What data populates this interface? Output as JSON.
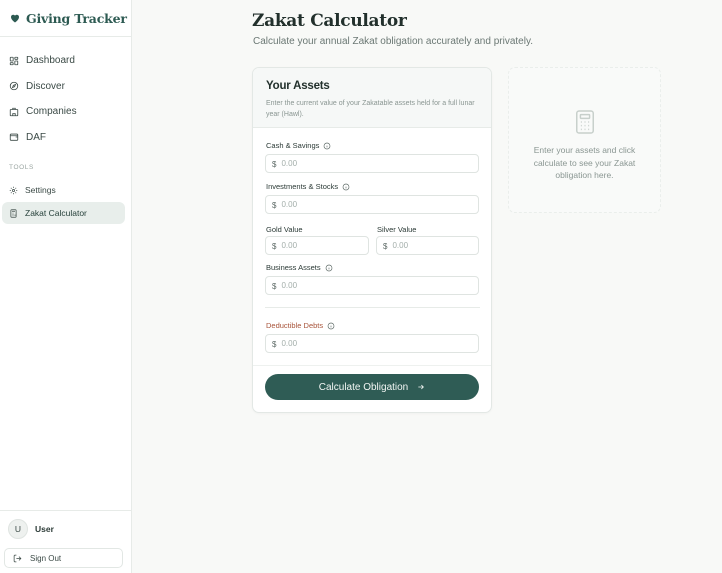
{
  "brand": {
    "name": "Giving Tracker",
    "icon": "heart-icon"
  },
  "nav": [
    {
      "label": "Dashboard",
      "icon": "grid-icon"
    },
    {
      "label": "Discover",
      "icon": "compass-icon"
    },
    {
      "label": "Companies",
      "icon": "building-icon"
    },
    {
      "label": "DAF",
      "icon": "wallet-icon"
    }
  ],
  "tools": {
    "heading": "TOOLS",
    "items": [
      {
        "label": "Settings",
        "icon": "gear-icon"
      },
      {
        "label": "Zakat Calculator",
        "icon": "calculator-icon",
        "active": true
      }
    ]
  },
  "user": {
    "initial": "U",
    "name": "User"
  },
  "signout": {
    "label": "Sign Out",
    "icon": "sign-out-icon"
  },
  "page": {
    "title": "Zakat Calculator",
    "subtitle": "Calculate your annual Zakat obligation accurately and privately."
  },
  "assets": {
    "title": "Your Assets",
    "description": "Enter the current value of your Zakatable assets held for a full lunar year (Hawl).",
    "currency": "$",
    "fields": {
      "cash": {
        "label": "Cash & Savings",
        "placeholder": "0.00"
      },
      "investments": {
        "label": "Investments & Stocks",
        "placeholder": "0.00"
      },
      "gold": {
        "label": "Gold Value",
        "placeholder": "0.00"
      },
      "silver": {
        "label": "Silver Value",
        "placeholder": "0.00"
      },
      "business": {
        "label": "Business Assets",
        "placeholder": "0.00"
      },
      "debts": {
        "label": "Deductible Debts",
        "placeholder": "0.00"
      }
    },
    "button": "Calculate Obligation"
  },
  "result": {
    "message": "Enter your assets and click calculate to see your Zakat obligation here."
  },
  "colors": {
    "accent": "#2f5c55",
    "debt_label": "#a8543a",
    "active_nav_bg": "#e8eeeb"
  }
}
